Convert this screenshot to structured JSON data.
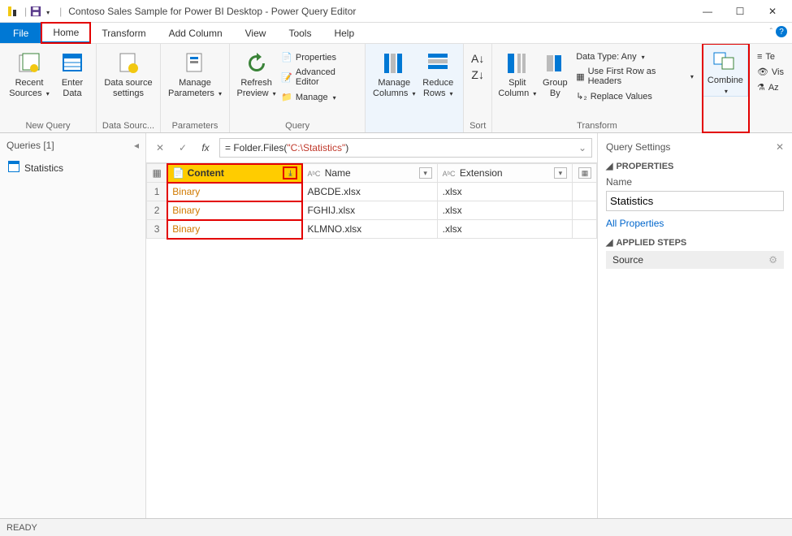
{
  "title": "Contoso Sales Sample for Power BI Desktop - Power Query Editor",
  "qat": {
    "save_icon": "save-icon",
    "dropdown_icon": "dropdown-icon",
    "separator": "|"
  },
  "window_controls": {
    "min": "—",
    "max": "☐",
    "close": "✕"
  },
  "menu": {
    "file": "File",
    "home": "Home",
    "transform": "Transform",
    "add_column": "Add Column",
    "view": "View",
    "tools": "Tools",
    "help": "Help"
  },
  "help_icon": "?",
  "ribbon": {
    "new_query": {
      "label": "New Query",
      "recent_sources": "Recent Sources",
      "enter_data": "Enter Data"
    },
    "data_sources": {
      "label": "Data Sourc...",
      "settings": "Data source settings"
    },
    "parameters": {
      "label": "Parameters",
      "manage": "Manage Parameters"
    },
    "query": {
      "label": "Query",
      "refresh": "Refresh Preview",
      "properties": "Properties",
      "adv_editor": "Advanced Editor",
      "manage": "Manage"
    },
    "manage_cols": {
      "label": "",
      "manage_columns": "Manage Columns",
      "reduce_rows": "Reduce Rows"
    },
    "sort": {
      "label": "Sort"
    },
    "transform": {
      "label": "Transform",
      "split": "Split Column",
      "group": "Group By",
      "data_type": "Data Type: Any",
      "first_row": "Use First Row as Headers",
      "replace": "Replace Values"
    },
    "combine": {
      "label": "Combine"
    },
    "view": {
      "text": "Te",
      "vis": "Vis",
      "az": "Az"
    }
  },
  "queries_panel": {
    "header": "Queries [1]",
    "item": "Statistics"
  },
  "formula": {
    "fx": "fx",
    "prefix": "= Folder.Files(",
    "path": "\"C:\\Statistics\"",
    "suffix": ")"
  },
  "grid": {
    "type_abc": "AᵇC",
    "col_index": "",
    "col_content": "Content",
    "col_name": "Name",
    "col_extension": "Extension",
    "rows": [
      {
        "n": "1",
        "content": "Binary",
        "name": "ABCDE.xlsx",
        "ext": ".xlsx"
      },
      {
        "n": "2",
        "content": "Binary",
        "name": "FGHIJ.xlsx",
        "ext": ".xlsx"
      },
      {
        "n": "3",
        "content": "Binary",
        "name": "KLMNO.xlsx",
        "ext": ".xlsx"
      }
    ]
  },
  "right": {
    "title": "Query Settings",
    "properties": "PROPERTIES",
    "name_label": "Name",
    "name_value": "Statistics",
    "all_props": "All Properties",
    "applied_steps": "APPLIED STEPS",
    "step_source": "Source",
    "gear": "⚙"
  },
  "status": "READY",
  "icons": {
    "triangle_down": "▾",
    "x": "✕",
    "check": "✓",
    "expand": "⤡"
  }
}
